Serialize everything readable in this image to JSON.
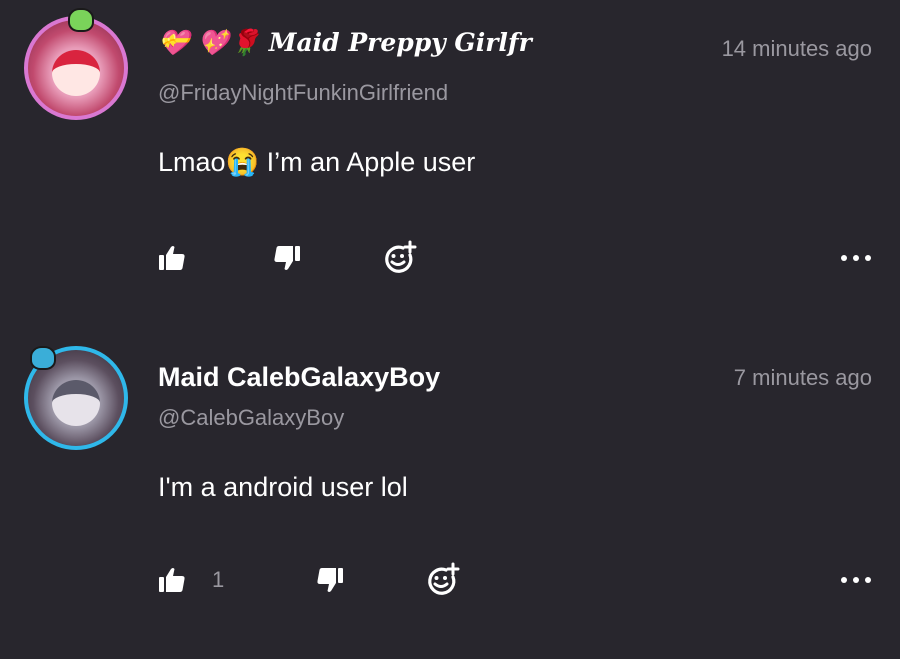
{
  "comments": [
    {
      "name": "💝 💖🌹 𝑴𝒂𝒊𝒅 𝑷𝒓𝒆𝒑𝒑𝒚 𝑮𝒊𝒓𝒍𝒇𝒓",
      "handle": "@FridayNightFunkinGirlfriend",
      "time": "14 minutes ago",
      "text": "Lmao😭  I’m an Apple user",
      "likes": "",
      "avatar_ring_color": "#d978d2"
    },
    {
      "name": "Maid CalebGalaxyBoy",
      "handle": "@CalebGalaxyBoy",
      "time": "7 minutes ago",
      "text": "I'm a android user lol",
      "likes": "1",
      "avatar_ring_color": "#2fb8ea"
    }
  ],
  "icons": {
    "like": "thumbs-up-icon",
    "dislike": "thumbs-down-icon",
    "react": "add-emoji-icon",
    "more": "more-options-icon"
  },
  "colors": {
    "background": "#28262d",
    "text_primary": "#ffffff",
    "text_secondary": "#9a98a0"
  }
}
